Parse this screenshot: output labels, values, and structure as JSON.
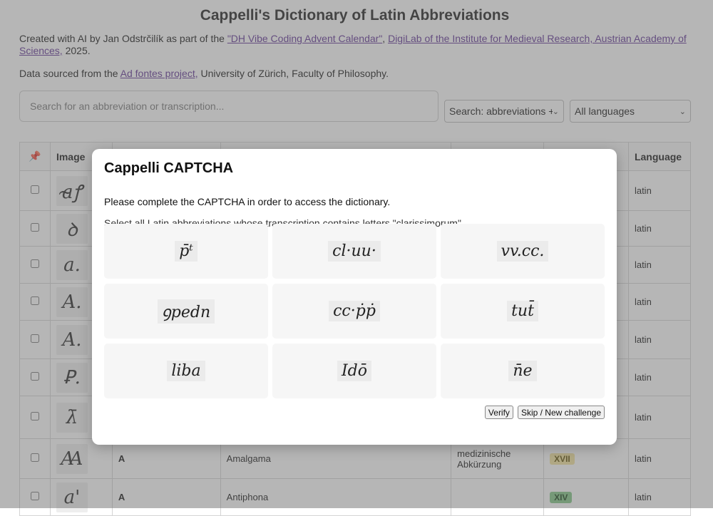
{
  "header": {
    "title": "Cappelli's Dictionary of Latin Abbreviations",
    "credit_prefix": "Created with AI by Jan Odstrčilík as part of the ",
    "credit_link1": "\"DH Vibe Coding Advent Calendar\"",
    "credit_sep": ", ",
    "credit_link2": "DigiLab of the Institute for Medieval Research, Austrian Academy of Sciences,",
    "credit_suffix": " 2025.",
    "source_prefix": "Data sourced from the ",
    "source_link": "Ad fontes project,",
    "source_suffix": " University of Zürich, Faculty of Philosophy."
  },
  "search": {
    "placeholder": "Search for an abbreviation or transcription...",
    "mode_value": "Search: abbreviations +",
    "language_value": "All languages"
  },
  "table": {
    "headers": {
      "pin": "📌",
      "image": "Image",
      "language": "Language"
    },
    "rows": [
      {
        "glyph": "a̴ꝭ",
        "abbr": "",
        "transcription": "",
        "type": "",
        "century": "",
        "language": "latin"
      },
      {
        "glyph": "ꝺ",
        "abbr": "",
        "transcription": "",
        "type": "",
        "century": "",
        "language": "latin"
      },
      {
        "glyph": "a.",
        "abbr": "",
        "transcription": "",
        "type": "",
        "century": "",
        "language": "latin"
      },
      {
        "glyph": "A.",
        "abbr": "",
        "transcription": "",
        "type": "",
        "century": "",
        "language": "latin"
      },
      {
        "glyph": "A.",
        "abbr": "",
        "transcription": "",
        "type": "",
        "century": "",
        "language": "latin"
      },
      {
        "glyph": "Ꝑ.",
        "abbr": "",
        "transcription": "",
        "type": "",
        "century": "",
        "language": "latin"
      },
      {
        "glyph": "λ̄",
        "abbr": "",
        "transcription": "",
        "type": "",
        "century": "",
        "language": "latin"
      },
      {
        "glyph": "Ꜳ",
        "abbr": "A",
        "transcription": "Amalgama",
        "type": "medizinische Abkürzung",
        "century": "XVII",
        "century_color": "yellow",
        "language": "latin"
      },
      {
        "glyph": "a'",
        "abbr": "A",
        "transcription": "Antiphona",
        "type": "",
        "century": "XIV",
        "century_color": "green",
        "language": "latin"
      }
    ]
  },
  "captcha": {
    "title": "Cappelli CAPTCHA",
    "intro": "Please complete the CAPTCHA in order to access the dictionary.",
    "instruction": "Select all Latin abbreviations whose transcription contains letters \"clarissimorum\"",
    "tiles": [
      {
        "glyph": "p̄ᵗ"
      },
      {
        "glyph": "cl·uu·"
      },
      {
        "glyph": "vv.cc."
      },
      {
        "glyph": "ꝯpedn"
      },
      {
        "glyph": "cc·ṗṗ"
      },
      {
        "glyph": "tut̄"
      },
      {
        "glyph": "liba"
      },
      {
        "glyph": "Idō"
      },
      {
        "glyph": "n̄e"
      }
    ],
    "verify_label": "Verify",
    "skip_label": "Skip / New challenge"
  },
  "colors": {
    "link": "#5b2d91",
    "badge_yellow": "#f3e29a",
    "badge_green": "#7fc583"
  }
}
